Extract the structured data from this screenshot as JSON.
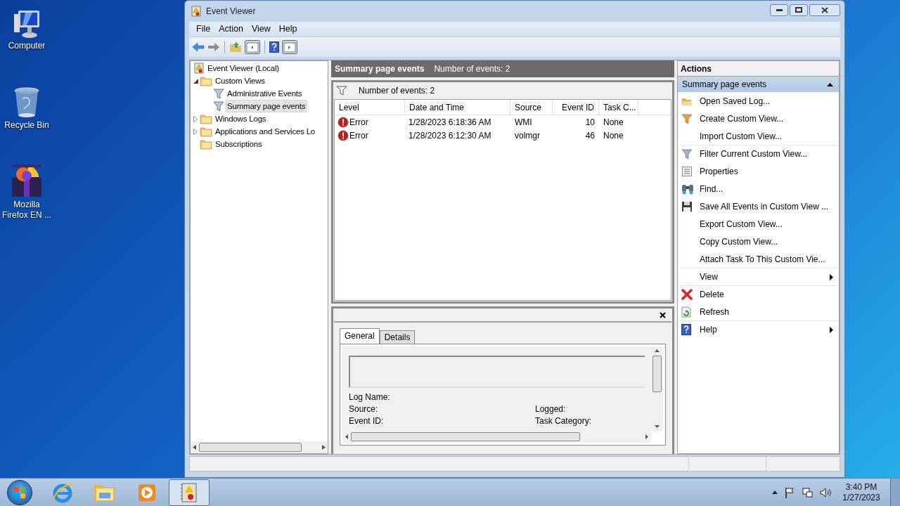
{
  "desktop_icons": [
    {
      "label": "Computer",
      "kind": "computer"
    },
    {
      "label": "Recycle Bin",
      "kind": "bin"
    },
    {
      "label": "Mozilla Firefox EN ...",
      "kind": "box"
    }
  ],
  "window": {
    "title": "Event Viewer",
    "menu": [
      "File",
      "Action",
      "View",
      "Help"
    ],
    "tree": {
      "label": "Event Viewer (Local)",
      "kind": "root",
      "selected": false,
      "children": [
        {
          "label": "Custom Views",
          "kind": "folder",
          "expanded": true,
          "selected": false,
          "children": [
            {
              "label": "Administrative Events",
              "kind": "filter",
              "selected": false
            },
            {
              "label": "Summary page events",
              "kind": "filter",
              "selected": true
            }
          ]
        },
        {
          "label": "Windows Logs",
          "kind": "folder",
          "expanded": false,
          "selected": false
        },
        {
          "label": "Applications and Services Lo",
          "kind": "folder",
          "expanded": false,
          "selected": false
        },
        {
          "label": "Subscriptions",
          "kind": "folder",
          "selected": false
        }
      ]
    },
    "center": {
      "title": "Summary page events",
      "count": "Number of events: 2",
      "filter_text": "Number of events: 2",
      "columns": [
        "Level",
        "Date and Time",
        "Source",
        "Event ID",
        "Task C..."
      ],
      "rows": [
        {
          "level": "Error",
          "date": "1/28/2023 6:18:36 AM",
          "source": "WMI",
          "event_id": "10",
          "task": "None"
        },
        {
          "level": "Error",
          "date": "1/28/2023 6:12:30 AM",
          "source": "volmgr",
          "event_id": "46",
          "task": "None"
        }
      ],
      "tabs": [
        {
          "label": "General",
          "selected": true
        },
        {
          "label": "Details",
          "selected": false
        }
      ],
      "fields": [
        [
          "Log Name:"
        ],
        [
          "Source:",
          "Logged:"
        ],
        [
          "Event ID:",
          "Task Category:"
        ]
      ]
    },
    "actions": {
      "title": "Actions",
      "section": "Summary page events",
      "items": [
        {
          "label": "Open Saved Log...",
          "kind": "open",
          "separator_before": false,
          "submenu": false
        },
        {
          "label": "Create Custom View...",
          "kind": "create",
          "separator_before": false,
          "submenu": false
        },
        {
          "label": "Import Custom View...",
          "kind": "none",
          "separator_before": false,
          "submenu": false
        },
        {
          "label": "Filter Current Custom View...",
          "kind": "filter",
          "separator_before": true,
          "submenu": false
        },
        {
          "label": "Properties",
          "kind": "properties",
          "separator_before": false,
          "submenu": false
        },
        {
          "label": "Find...",
          "kind": "find",
          "separator_before": false,
          "submenu": false
        },
        {
          "label": "Save All Events in Custom View ...",
          "kind": "save",
          "separator_before": false,
          "submenu": false
        },
        {
          "label": "Export Custom View...",
          "kind": "none",
          "separator_before": false,
          "submenu": false
        },
        {
          "label": "Copy Custom View...",
          "kind": "none",
          "separator_before": false,
          "submenu": false
        },
        {
          "label": "Attach Task To This Custom Vie...",
          "kind": "none",
          "separator_before": false,
          "submenu": false
        },
        {
          "label": "View",
          "kind": "none",
          "separator_before": true,
          "submenu": true
        },
        {
          "label": "Delete",
          "kind": "delete",
          "separator_before": true,
          "submenu": false
        },
        {
          "label": "Refresh",
          "kind": "refresh",
          "separator_before": false,
          "submenu": false
        },
        {
          "label": "Help",
          "kind": "help",
          "separator_before": true,
          "submenu": true
        }
      ]
    }
  },
  "taskbar": {
    "apps": [
      {
        "kind": "ie",
        "active": false
      },
      {
        "kind": "explorer",
        "active": false
      },
      {
        "kind": "media",
        "active": false
      },
      {
        "kind": "eventviewer",
        "active": true
      }
    ],
    "time": "3:40 PM",
    "date": "1/27/2023"
  }
}
